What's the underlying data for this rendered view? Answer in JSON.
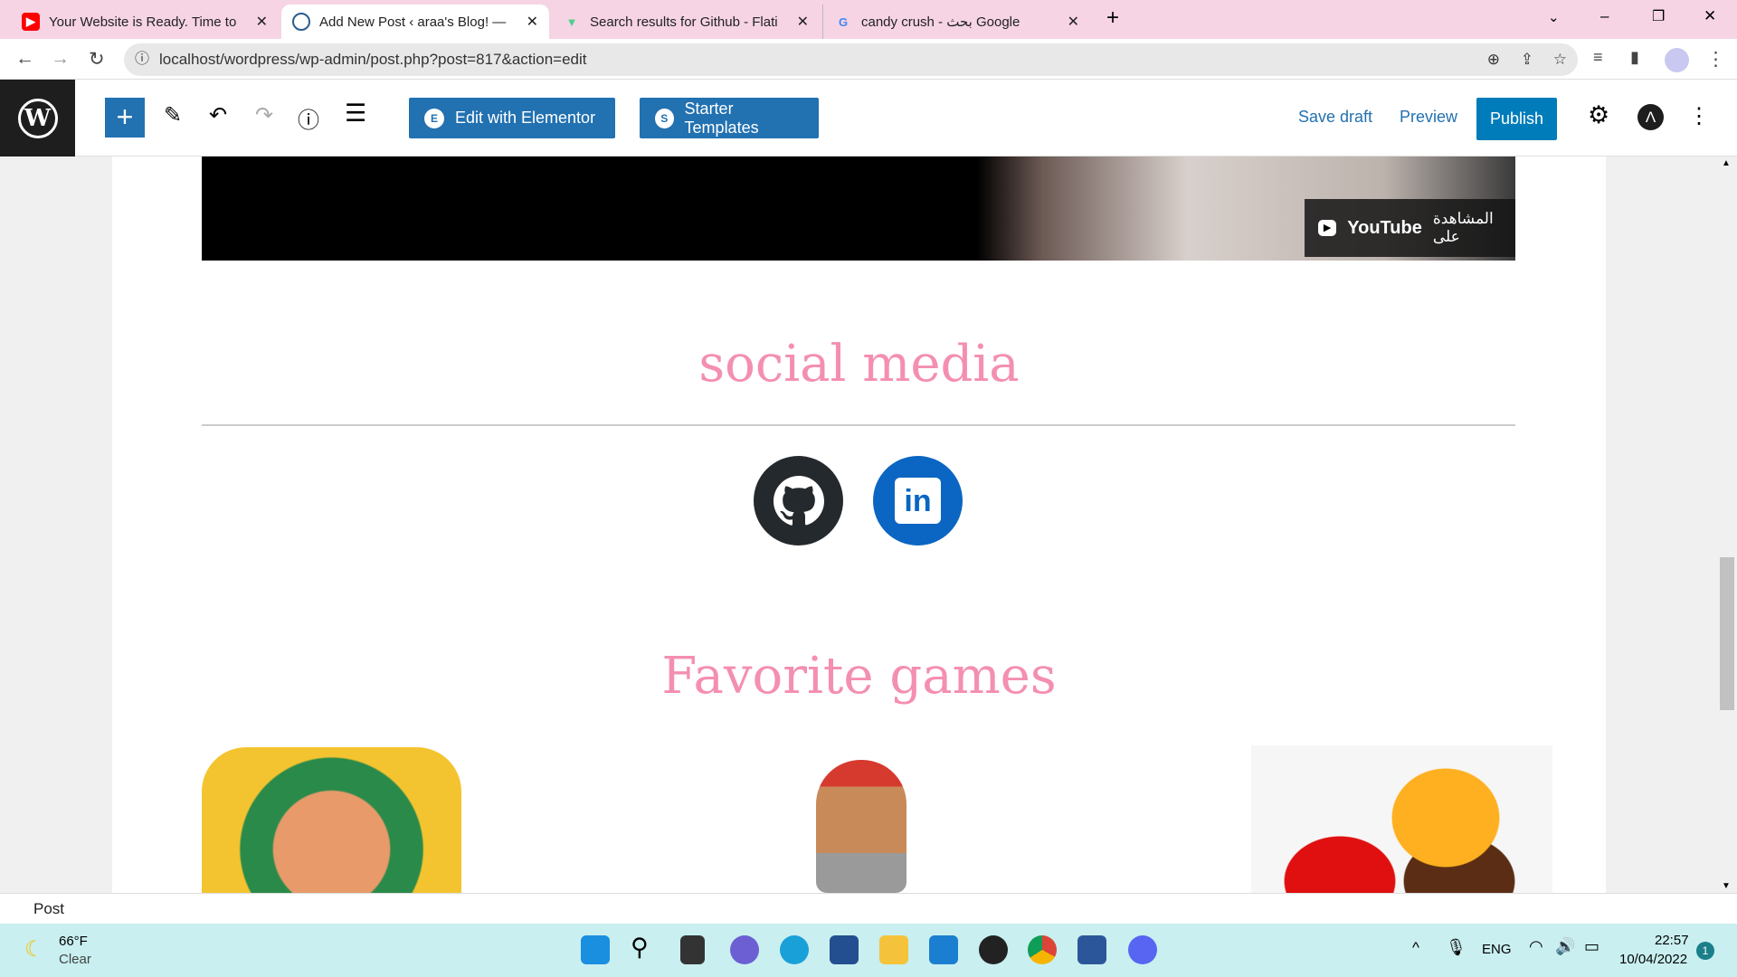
{
  "browser": {
    "tabs": [
      {
        "title": "Your Website is Ready. Time to Pu",
        "icon": "youtube-icon",
        "color": "#ff0000"
      },
      {
        "title": "Add New Post ‹ araa's Blog! — W",
        "icon": "wordpress-icon",
        "color": "#2c5d8f"
      },
      {
        "title": "Search results for Github - Flatico",
        "icon": "flaticon-icon",
        "color": "#4bd08b"
      },
      {
        "title": "candy crush - بحث Google",
        "icon": "google-icon",
        "color": "#4285f4"
      }
    ],
    "url": "localhost/wordpress/wp-admin/post.php?post=817&action=edit"
  },
  "toolbar": {
    "elementor_label": "Edit with Elementor",
    "starter_label": "Starter Templates",
    "save_draft": "Save draft",
    "preview": "Preview",
    "publish": "Publish"
  },
  "content": {
    "video_watch_on": "المشاهدة على",
    "video_youtube": "YouTube",
    "social_heading": "social media",
    "favorite_heading": "Favorite games",
    "social_links": [
      {
        "name": "github",
        "color": "#24292e"
      },
      {
        "name": "linkedin",
        "color": "#0a66c2"
      }
    ]
  },
  "status": {
    "label": "Post"
  },
  "taskbar": {
    "weather_temp": "66°F",
    "weather_desc": "Clear",
    "lang": "ENG",
    "time": "22:57",
    "date": "10/04/2022",
    "notifications": "1"
  },
  "colors": {
    "accent": "#2271b1",
    "heading": "#f48fb1"
  }
}
